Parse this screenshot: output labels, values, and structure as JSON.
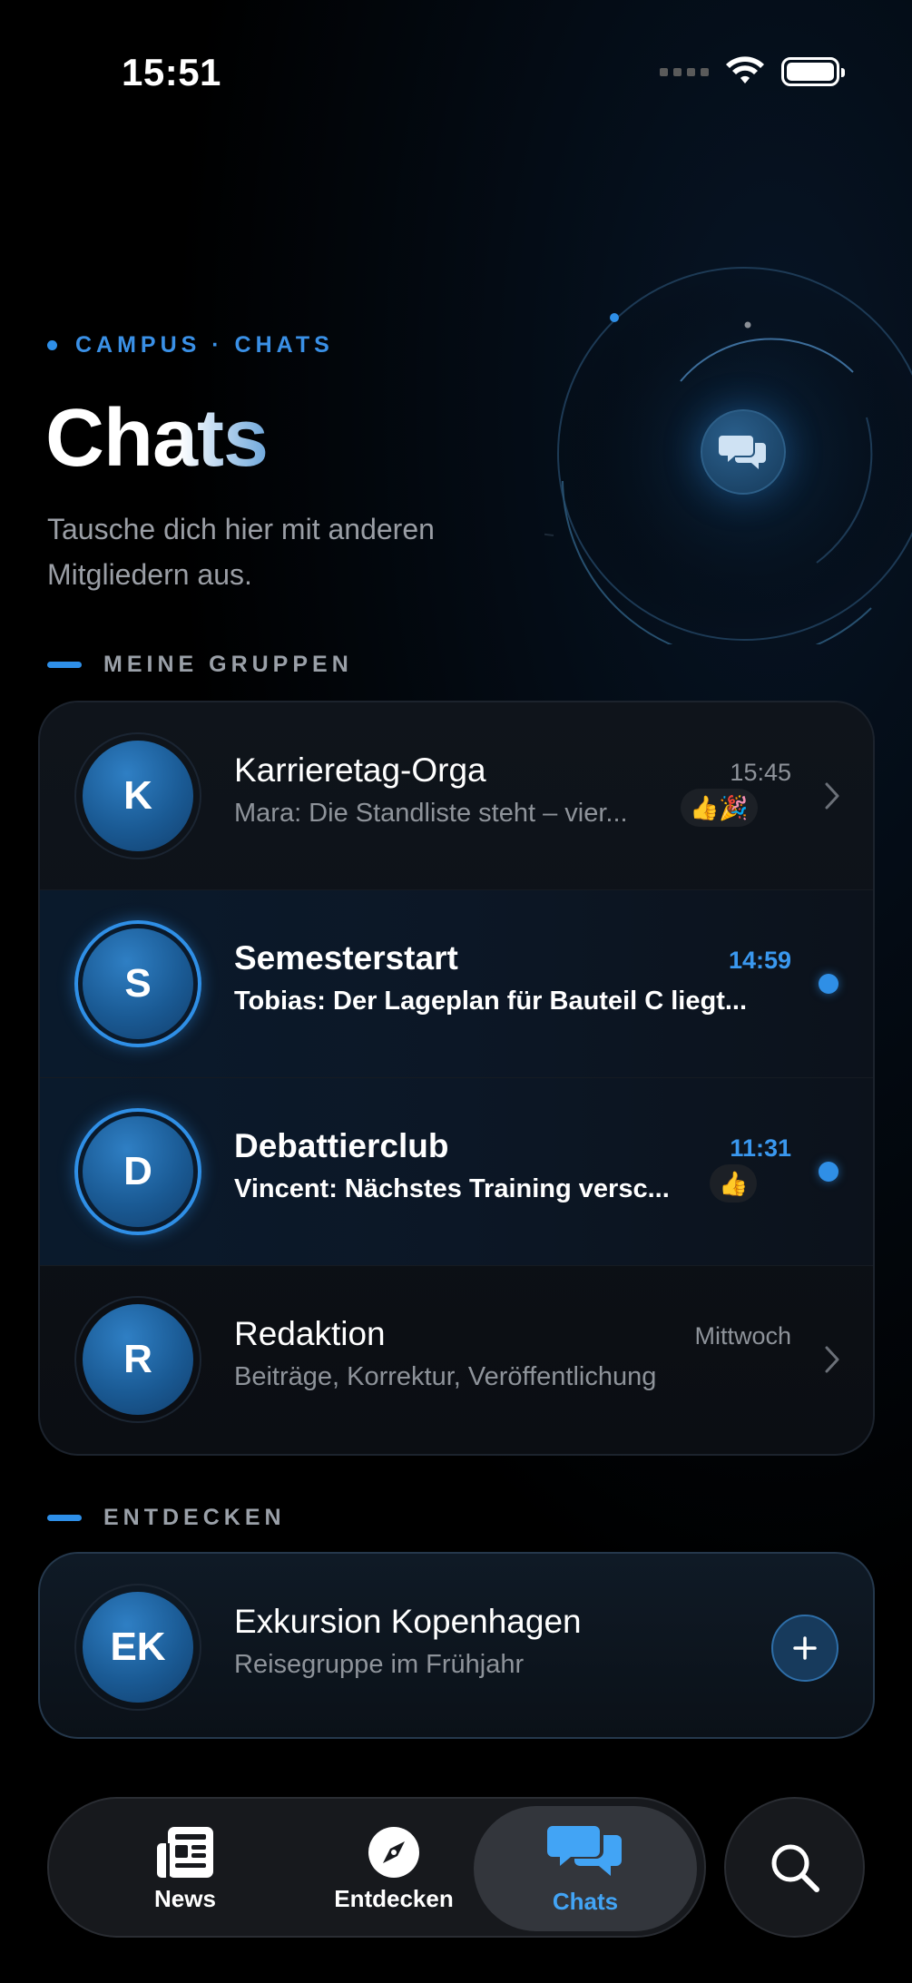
{
  "status_bar": {
    "time": "15:51"
  },
  "header": {
    "eyebrow": "CAMPUS · CHATS",
    "title": "Chats",
    "subtitle": "Tausche dich hier mit anderen Mitgliedern aus."
  },
  "groups_section": {
    "label": "MEINE GRUPPEN",
    "items": [
      {
        "initial": "K",
        "name": "Karrieretag-Orga",
        "preview": "Mara: Die Standliste steht – vier...",
        "time": "15:45",
        "reactions": "👍🎉",
        "unread": false
      },
      {
        "initial": "S",
        "name": "Semesterstart",
        "preview": "Tobias: Der Lageplan für Bauteil C liegt...",
        "time": "14:59",
        "reactions": "",
        "unread": true
      },
      {
        "initial": "D",
        "name": "Debattierclub",
        "preview": "Vincent: Nächstes Training versc...",
        "time": "11:31",
        "reactions": "👍",
        "unread": true
      },
      {
        "initial": "R",
        "name": "Redaktion",
        "preview": "Beiträge, Korrektur, Veröffentlichung",
        "time": "Mittwoch",
        "reactions": "",
        "unread": false
      }
    ]
  },
  "discover_section": {
    "label": "ENTDECKEN",
    "item": {
      "initial": "EK",
      "name": "Exkursion Kopenhagen",
      "preview": "Reisegruppe im Frühjahr"
    }
  },
  "tab_bar": {
    "tabs": [
      {
        "label": "News",
        "icon": "newspaper-icon",
        "active": false
      },
      {
        "label": "Entdecken",
        "icon": "compass-icon",
        "active": false
      },
      {
        "label": "Chats",
        "icon": "chat-bubbles-icon",
        "active": true
      }
    ],
    "search_icon": "search-icon"
  },
  "colors": {
    "accent": "#2e8fe8",
    "background": "#000000",
    "active_tab_label": "#42a4f5"
  }
}
